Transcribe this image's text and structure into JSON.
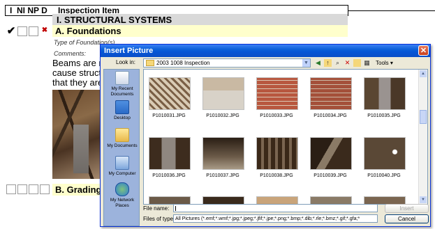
{
  "document": {
    "header": {
      "codes": "I  NI NP D",
      "item": "Inspection Item"
    },
    "section_title": "I. STRUCTURAL SYSTEMS",
    "foundations": {
      "checks": [
        "✔",
        "",
        "",
        "✖"
      ],
      "title": "A. Foundations",
      "type_label": "Type of Foundation(s)",
      "comments_label": "Comments:",
      "body_lines": [
        "Beams are n",
        "cause struct",
        "that they are"
      ]
    },
    "grading": {
      "title": "B. Grading a"
    }
  },
  "dialog": {
    "title": "Insert Picture",
    "close": "✕",
    "look_in_label": "Look in:",
    "look_in_value": "2003 1008 Inspection",
    "tools_label": "Tools ▾",
    "places": [
      {
        "label": "My Recent Documents",
        "icon": "recent-documents-icon"
      },
      {
        "label": "Desktop",
        "icon": "desktop-icon"
      },
      {
        "label": "My Documents",
        "icon": "my-documents-icon"
      },
      {
        "label": "My Computer",
        "icon": "my-computer-icon"
      },
      {
        "label": "My Network Places",
        "icon": "network-places-icon"
      }
    ],
    "files_row1": [
      "P1010031.JPG",
      "P1010032.JPG",
      "P1010033.JPG",
      "P1010034.JPG",
      "P1010035.JPG"
    ],
    "files_row2": [
      "P1010036.JPG",
      "P1010037.JPG",
      "P1010038.JPG",
      "P1010039.JPG",
      "P1010040.JPG"
    ],
    "file_name_label": "File name:",
    "file_name_value": "",
    "files_of_type_label": "Files of type:",
    "files_of_type_value": "All Pictures (*.emf;*.wmf;*.jpg;*.jpeg;*.jfif;*.jpe;*.png;*.bmp;*.dib;*.rle;*.bmz;*.gif;*.gfa;*",
    "insert_button": "Insert",
    "cancel_button": "Cancel"
  }
}
